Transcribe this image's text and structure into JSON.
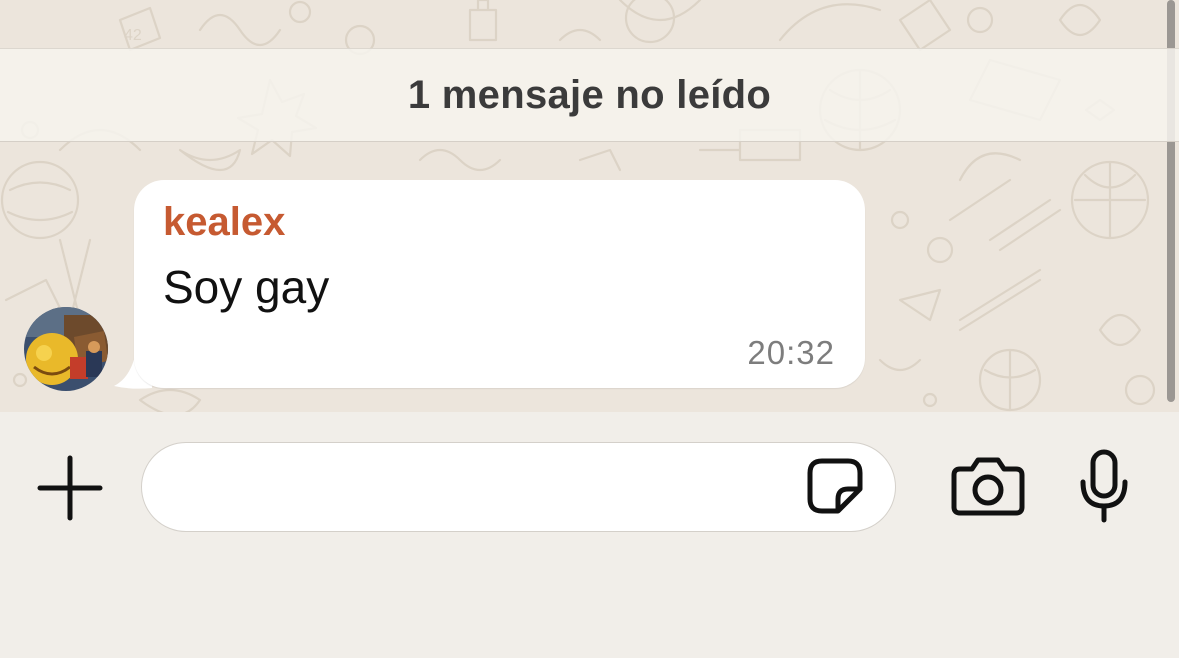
{
  "unread_banner": {
    "text": "1 mensaje no leído"
  },
  "message": {
    "sender": "kealex",
    "text": "Soy gay",
    "time": "20:32",
    "sender_color": "#c65a31"
  },
  "composer": {
    "value": "",
    "placeholder": ""
  },
  "icons": {
    "plus": "plus-icon",
    "sticker": "sticker-icon",
    "camera": "camera-icon",
    "microphone": "microphone-icon",
    "avatar": "profile-avatar"
  },
  "colors": {
    "wallpaper": "#ece5dc",
    "bubble": "#ffffff",
    "input_bar": "#f1eee9",
    "icon": "#111111"
  }
}
